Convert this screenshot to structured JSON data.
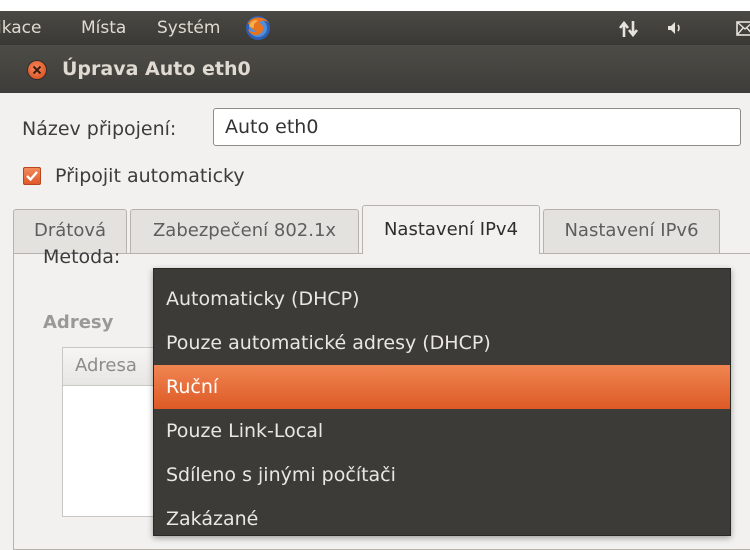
{
  "top_panel": {
    "menus": [
      "ikace",
      "Místa",
      "Systém"
    ],
    "icons": [
      "firefox-icon",
      "network-icon",
      "volume-icon",
      "mail-icon"
    ]
  },
  "window": {
    "title": "Úprava Auto eth0"
  },
  "form": {
    "connection_name_label": "Název připojení:",
    "connection_name_value": "Auto eth0",
    "auto_connect_label": "Připojit automaticky",
    "auto_connect_checked": true
  },
  "tabs": [
    {
      "label": "Drátová",
      "active": false
    },
    {
      "label": "Zabezpečení 802.1x",
      "active": false
    },
    {
      "label": "Nastavení IPv4",
      "active": true
    },
    {
      "label": "Nastavení IPv6",
      "active": false
    }
  ],
  "ipv4": {
    "method_label": "Metoda:",
    "addresses_heading": "Adresy",
    "addresses_column": "Adresa"
  },
  "method_dropdown": {
    "options": [
      "Automaticky (DHCP)",
      "Pouze automatické adresy (DHCP)",
      "Ruční",
      "Pouze Link-Local",
      "Sdíleno s jinými počítači",
      "Zakázané"
    ],
    "selected_index": 2
  },
  "colors": {
    "accent": "#e66a35",
    "panel": "#3c3b37"
  }
}
